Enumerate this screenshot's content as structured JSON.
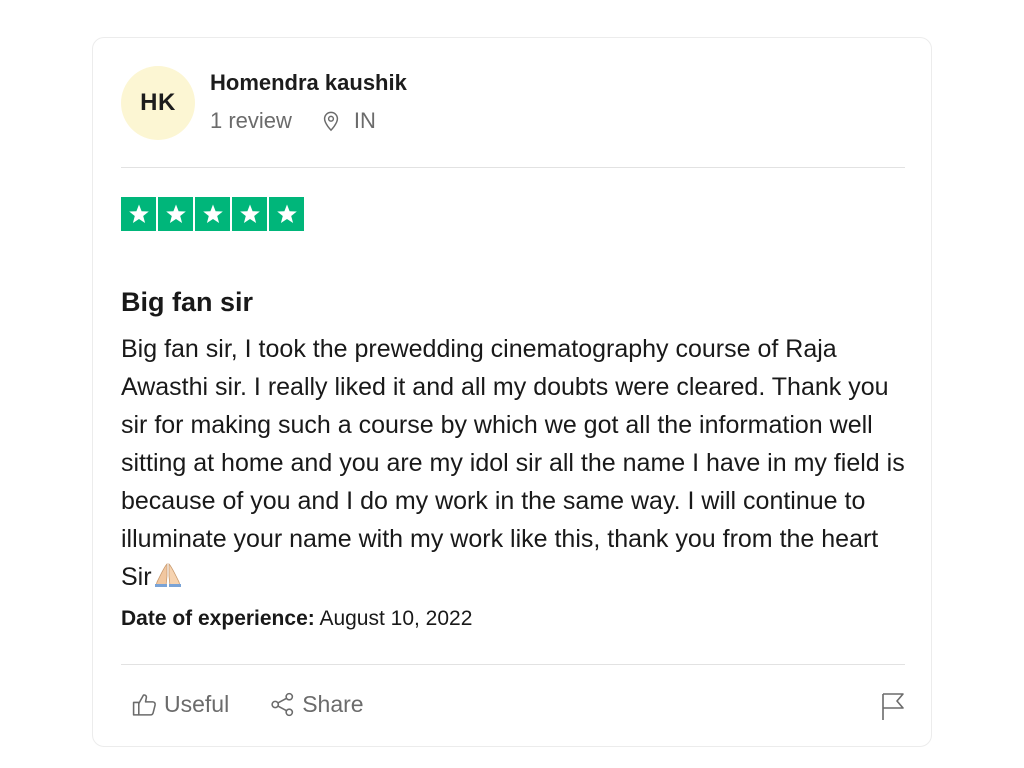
{
  "reviewer": {
    "initials": "HK",
    "name": "Homendra kaushik",
    "review_count": "1 review",
    "location": "IN",
    "avatar_color": "#fcf6d3"
  },
  "rating": {
    "stars": 5,
    "max_stars": 5,
    "star_color": "#00b67a",
    "star_icon": "star-icon"
  },
  "review": {
    "title": "Big fan sir",
    "body": "Big fan sir, I took the prewedding cinematography course of Raja Awasthi sir. I really liked it and all my doubts were cleared. Thank you sir for making such a course by which we got all the information well sitting at home and you are my idol sir all the name I have in my field is because of you and I do my work in the same way. I will continue to illuminate your name with my work like this, thank you from the heart Sir",
    "body_end_icon": "folded-hands-emoji"
  },
  "experience": {
    "label": "Date of experience:",
    "date": "August 10, 2022"
  },
  "actions": {
    "useful_label": "Useful",
    "useful_icon": "thumbs-up-icon",
    "share_label": "Share",
    "share_icon": "share-icon",
    "report_icon": "flag-icon"
  },
  "location_icon": "map-pin-icon"
}
